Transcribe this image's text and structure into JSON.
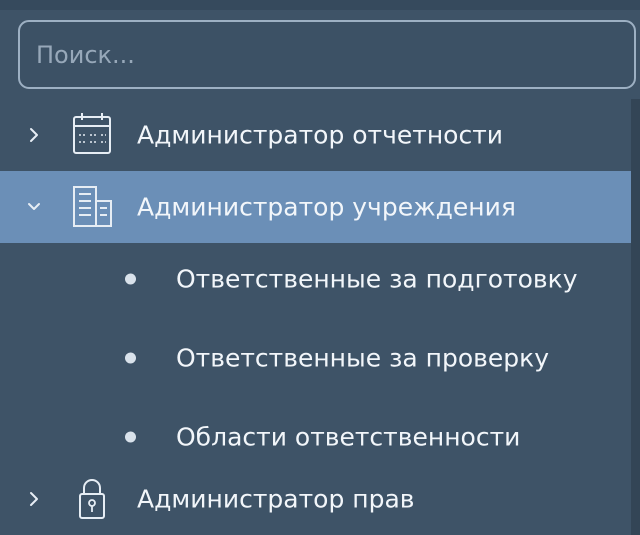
{
  "search": {
    "placeholder": "Поиск..."
  },
  "tree": {
    "items": [
      {
        "label": "Администратор отчетности",
        "expanded": false,
        "icon": "calendar-icon"
      },
      {
        "label": "Администратор учреждения",
        "expanded": true,
        "selected": true,
        "icon": "building-icon",
        "children": [
          {
            "label": "Ответственные за подготовку"
          },
          {
            "label": "Ответственные за проверку"
          },
          {
            "label": "Области ответственности"
          }
        ]
      },
      {
        "label": "Администратор прав",
        "expanded": false,
        "icon": "lock-icon"
      }
    ]
  },
  "colors": {
    "background": "#3e5367",
    "selected": "#6b8fb7",
    "text": "#f2f6fa",
    "search_border": "#9db0c3",
    "placeholder": "#97a8b9"
  }
}
